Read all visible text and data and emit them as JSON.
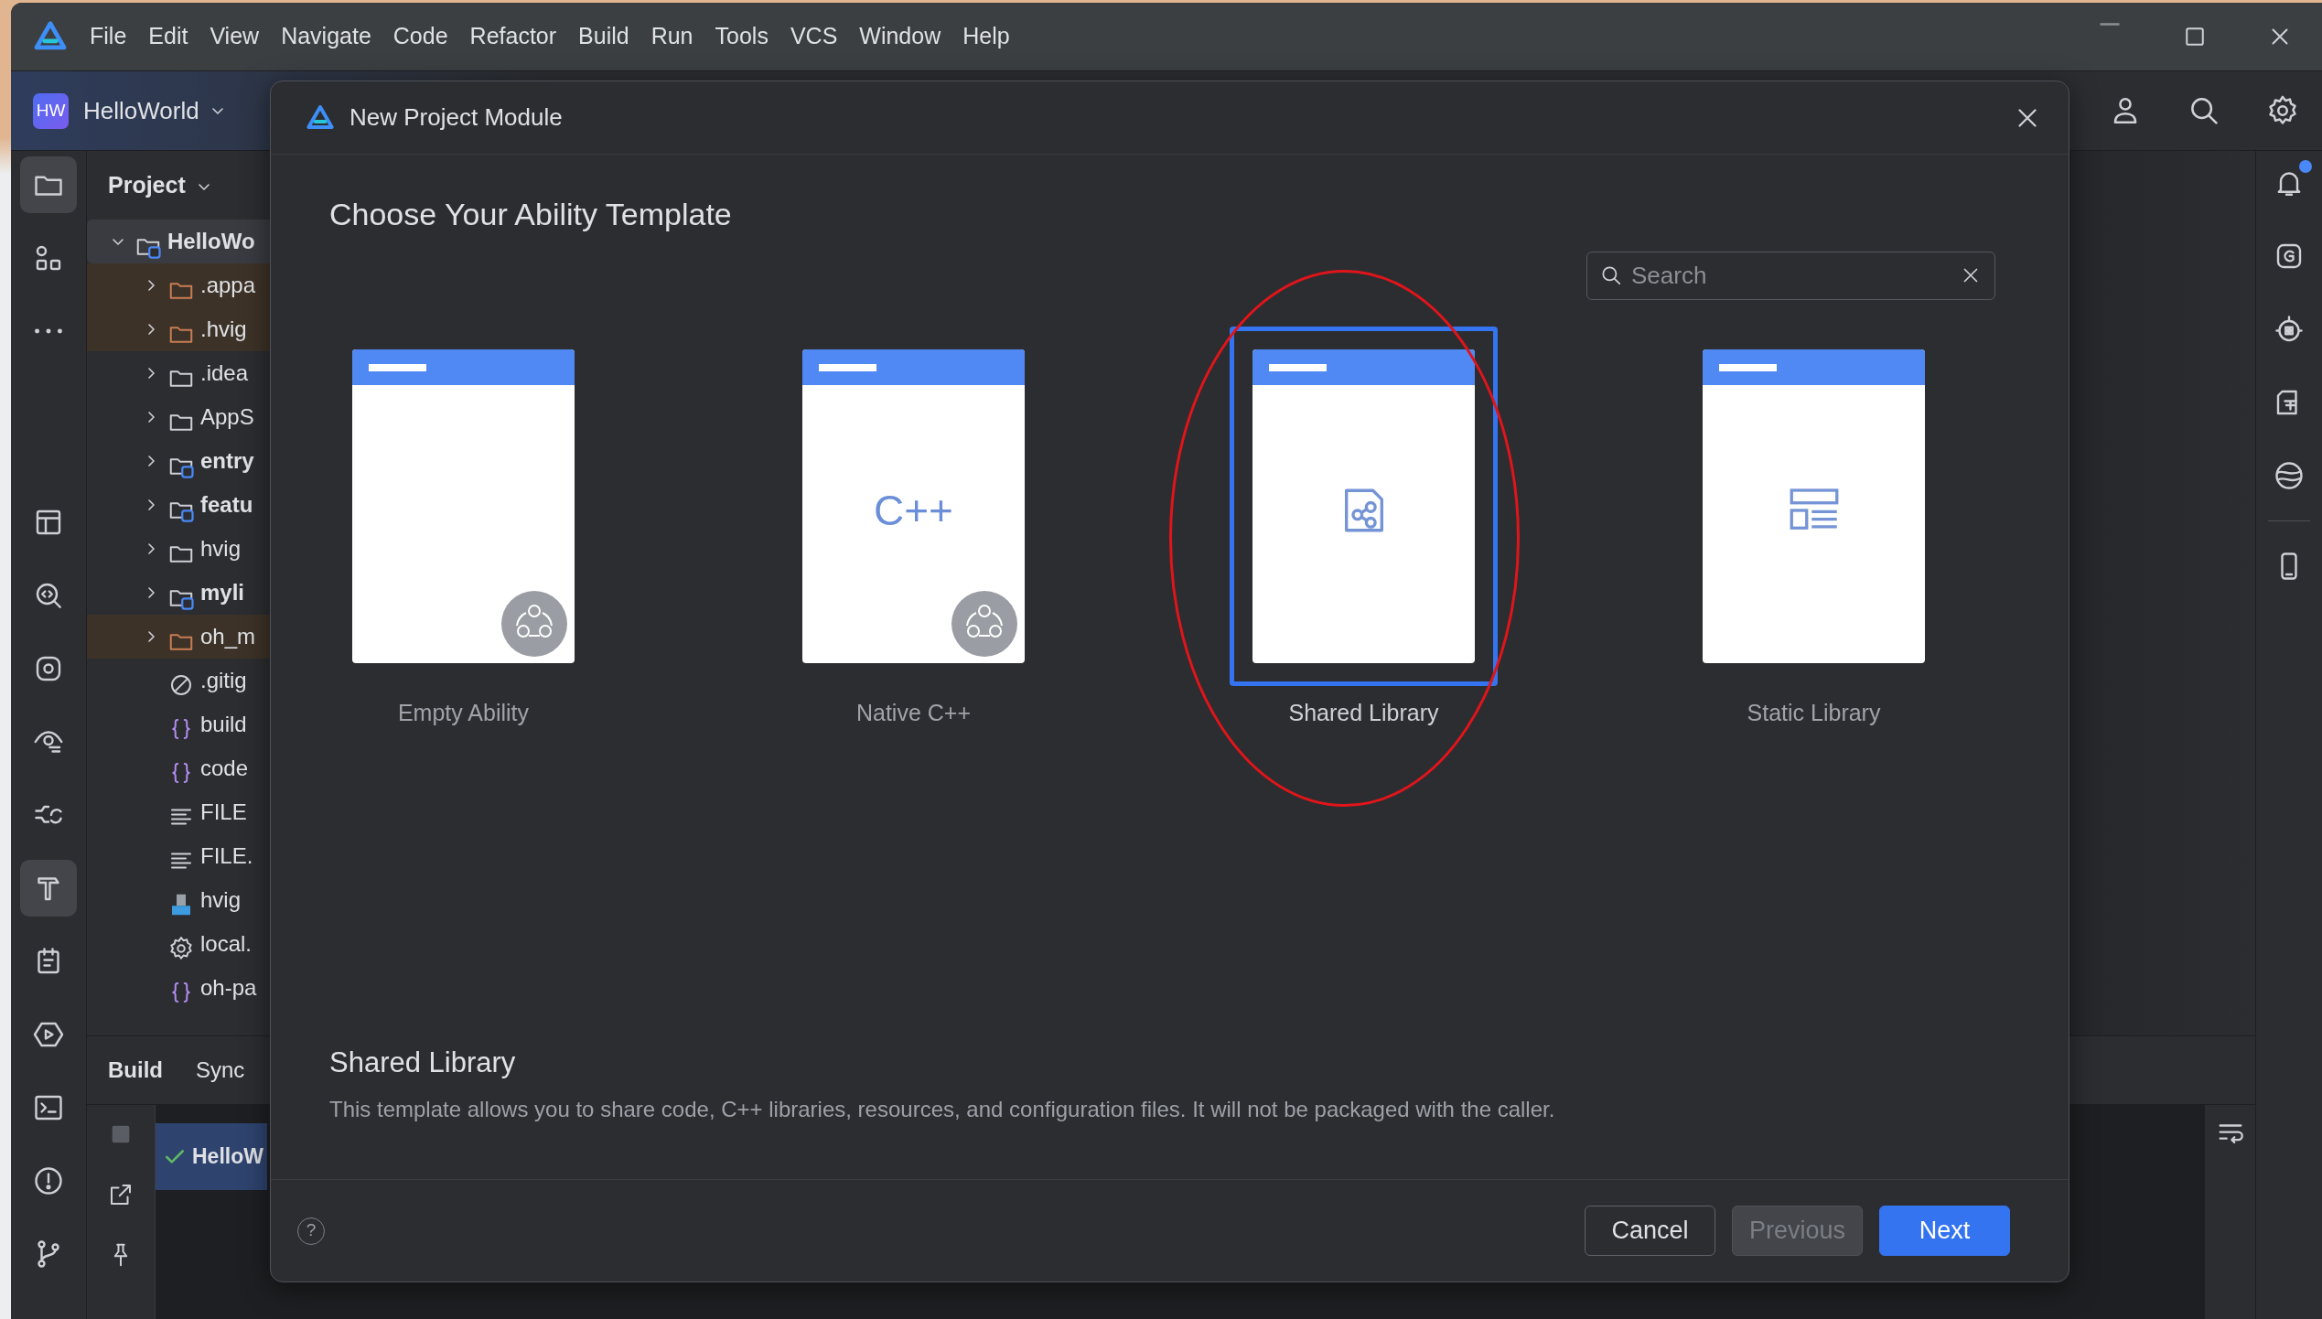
{
  "menu": [
    {
      "label": "File"
    },
    {
      "label": "Edit"
    },
    {
      "label": "View"
    },
    {
      "label": "Navigate"
    },
    {
      "label": "Code"
    },
    {
      "label": "Refactor"
    },
    {
      "label": "Build"
    },
    {
      "label": "Run"
    },
    {
      "label": "Tools"
    },
    {
      "label": "VCS"
    },
    {
      "label": "Window"
    },
    {
      "label": "Help"
    }
  ],
  "toolbar": {
    "project_badge": "HW",
    "project_name": "HelloWorld"
  },
  "left_toolbar": {
    "top": [
      {
        "selected": true
      },
      {
        "selected": false
      },
      {
        "selected": false
      }
    ],
    "bottom": [
      {
        "selected": false
      },
      {
        "selected": false
      },
      {
        "selected": false
      },
      {
        "selected": false
      },
      {
        "selected": false
      },
      {
        "selected": true
      },
      {
        "selected": false
      },
      {
        "selected": false
      },
      {
        "selected": false
      },
      {
        "selected": false
      },
      {
        "selected": false
      }
    ]
  },
  "right_toolbar": {
    "unread_notifications": true
  },
  "project_panel": {
    "title": "Project",
    "tree": [
      {
        "label": "HelloWo",
        "kind": "module",
        "expanded": true,
        "excluded": false,
        "selected": true,
        "children": [
          {
            "label": ".appa",
            "kind": "folder",
            "expanded": false,
            "excluded": true,
            "selected": false
          },
          {
            "label": ".hvig",
            "kind": "folder",
            "expanded": false,
            "excluded": true,
            "selected": false
          },
          {
            "label": ".idea",
            "kind": "folder",
            "expanded": false,
            "excluded": false,
            "selected": false
          },
          {
            "label": "AppS",
            "kind": "folder",
            "expanded": false,
            "excluded": false,
            "selected": false
          },
          {
            "label": "entry",
            "kind": "module",
            "expanded": false,
            "excluded": false,
            "selected": false
          },
          {
            "label": "featu",
            "kind": "module",
            "expanded": false,
            "excluded": false,
            "selected": false
          },
          {
            "label": "hvig",
            "kind": "folder",
            "expanded": false,
            "excluded": false,
            "selected": false
          },
          {
            "label": "myli",
            "kind": "module",
            "expanded": false,
            "excluded": false,
            "selected": false
          },
          {
            "label": "oh_m",
            "kind": "folder",
            "expanded": false,
            "excluded": true,
            "selected": false
          },
          {
            "label": ".gitig",
            "kind": "ignore",
            "selected": false
          },
          {
            "label": "build",
            "kind": "json",
            "selected": false
          },
          {
            "label": "code",
            "kind": "json",
            "selected": false
          },
          {
            "label": "FILE",
            "kind": "text",
            "selected": false
          },
          {
            "label": "FILE.",
            "kind": "text",
            "selected": false
          },
          {
            "label": "hvig",
            "kind": "ts",
            "selected": false
          },
          {
            "label": "local.",
            "kind": "settings",
            "selected": false
          },
          {
            "label": "oh-pa",
            "kind": "json",
            "selected": false
          }
        ]
      }
    ]
  },
  "bottom_panel": {
    "tabs": [
      {
        "label": "Build",
        "selected": true
      },
      {
        "label": "Sync",
        "selected": false
      }
    ],
    "build_items": [
      {
        "label": "HelloW",
        "succeeded": true,
        "selected": true
      }
    ]
  },
  "dialog": {
    "title": "New Project Module",
    "heading": "Choose Your Ability Template",
    "search": {
      "placeholder": "Search"
    },
    "templates": [
      {
        "label": "Empty Ability",
        "kind": "empty",
        "badge": true,
        "selected": false
      },
      {
        "label": "Native C++",
        "kind": "cpp",
        "icon_text": "C++",
        "badge": true,
        "selected": false
      },
      {
        "label": "Shared Library",
        "kind": "shared",
        "badge": false,
        "selected": true
      },
      {
        "label": "Static Library",
        "kind": "static",
        "badge": false,
        "selected": false
      }
    ],
    "description": {
      "title": "Shared Library",
      "text": "This template allows you to share code, C++ libraries, resources, and configuration files. It will not be packaged with the caller."
    },
    "help": "?",
    "buttons": [
      {
        "label": "Cancel",
        "kind": "secondary",
        "disabled": false
      },
      {
        "label": "Previous",
        "kind": "secondary",
        "disabled": true
      },
      {
        "label": "Next",
        "kind": "primary",
        "disabled": false
      }
    ]
  }
}
